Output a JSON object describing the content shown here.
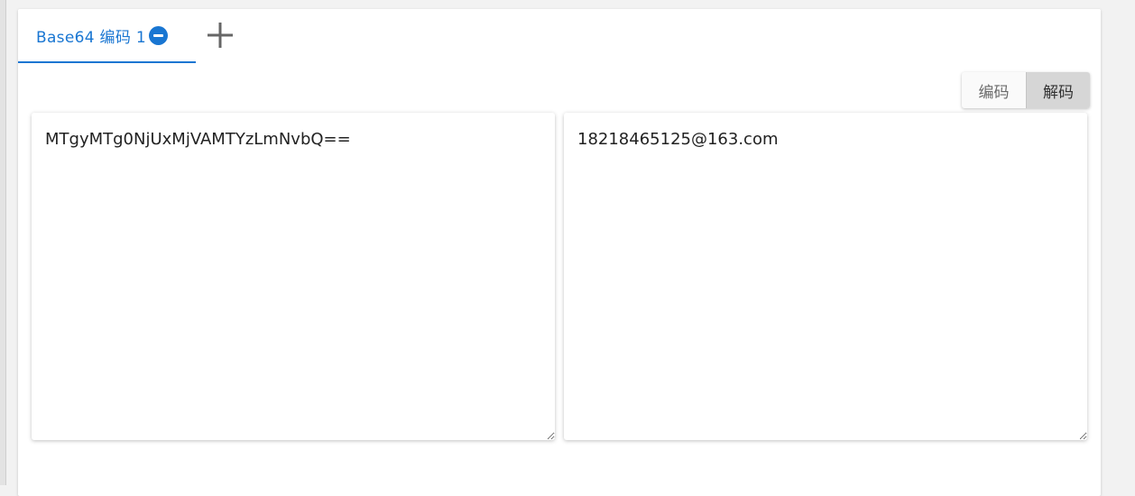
{
  "tabs": [
    {
      "label": "Base64 编码 1",
      "active": true
    }
  ],
  "add_tab": {
    "icon": "plus-icon"
  },
  "close_tab": {
    "icon": "minus-circle-icon"
  },
  "mode_toggle": {
    "encode_label": "编码",
    "decode_label": "解码",
    "selected": "解码"
  },
  "input_panel": {
    "value": "MTgyMTg0NjUxMjVAMTYzLmNvbQ=="
  },
  "output_panel": {
    "value": "18218465125@163.com"
  },
  "colors": {
    "accent": "#1976d2",
    "active_toggle_bg": "#d6d6d6",
    "page_bg": "#f2f2f2"
  }
}
